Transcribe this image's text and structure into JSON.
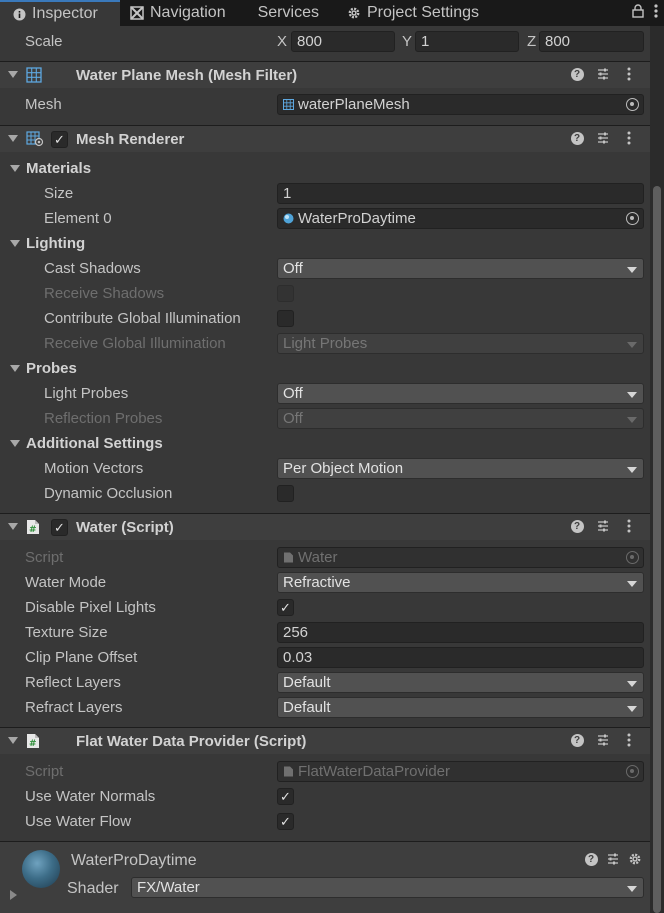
{
  "tabs": [
    {
      "label": "Inspector",
      "icon": "info-icon"
    },
    {
      "label": "Navigation",
      "icon": "navigation-icon"
    },
    {
      "label": "Services",
      "icon": ""
    },
    {
      "label": "Project Settings",
      "icon": "gear-icon"
    }
  ],
  "transform": {
    "scale_label": "Scale",
    "x_label": "X",
    "x_value": "800",
    "y_label": "Y",
    "y_value": "1",
    "z_label": "Z",
    "z_value": "800"
  },
  "mesh_filter": {
    "title": "Water Plane Mesh (Mesh Filter)",
    "mesh_label": "Mesh",
    "mesh_value": "waterPlaneMesh"
  },
  "mesh_renderer": {
    "title": "Mesh Renderer",
    "enabled": true,
    "materials_label": "Materials",
    "size_label": "Size",
    "size_value": "1",
    "element0_label": "Element 0",
    "element0_value": "WaterProDaytime",
    "lighting_label": "Lighting",
    "cast_shadows_label": "Cast Shadows",
    "cast_shadows_value": "Off",
    "receive_shadows_label": "Receive Shadows",
    "contribute_gi_label": "Contribute Global Illumination",
    "receive_gi_label": "Receive Global Illumination",
    "receive_gi_value": "Light Probes",
    "probes_label": "Probes",
    "light_probes_label": "Light Probes",
    "light_probes_value": "Off",
    "reflection_probes_label": "Reflection Probes",
    "reflection_probes_value": "Off",
    "additional_label": "Additional Settings",
    "motion_vectors_label": "Motion Vectors",
    "motion_vectors_value": "Per Object Motion",
    "dynamic_occlusion_label": "Dynamic Occlusion"
  },
  "water_script": {
    "title": "Water (Script)",
    "enabled": true,
    "script_label": "Script",
    "script_value": "Water",
    "water_mode_label": "Water Mode",
    "water_mode_value": "Refractive",
    "disable_pixel_lights_label": "Disable Pixel Lights",
    "disable_pixel_lights_checked": "✓",
    "texture_size_label": "Texture Size",
    "texture_size_value": "256",
    "clip_plane_label": "Clip Plane Offset",
    "clip_plane_value": "0.03",
    "reflect_layers_label": "Reflect Layers",
    "reflect_layers_value": "Default",
    "refract_layers_label": "Refract Layers",
    "refract_layers_value": "Default"
  },
  "flat_water": {
    "title": "Flat Water Data Provider (Script)",
    "script_label": "Script",
    "script_value": "FlatWaterDataProvider",
    "use_normals_label": "Use Water Normals",
    "use_normals_checked": "✓",
    "use_flow_label": "Use Water Flow",
    "use_flow_checked": "✓"
  },
  "material": {
    "name": "WaterProDaytime",
    "shader_label": "Shader",
    "shader_value": "FX/Water"
  },
  "check_mark": "✓",
  "colors": {
    "accent": "#3a79bb",
    "background": "#383838",
    "header": "#3e3e3e"
  }
}
